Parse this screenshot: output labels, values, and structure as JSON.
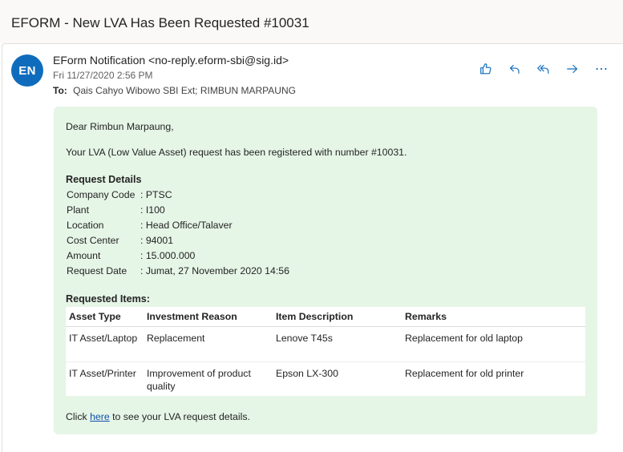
{
  "subject": "EFORM - New LVA Has Been Requested #10031",
  "sender": {
    "initials": "EN",
    "display": "EForm Notification <no-reply.eform-sbi@sig.id>",
    "date": "Fri 11/27/2020 2:56 PM",
    "to_label": "To:",
    "to": "Qais Cahyo Wibowo SBI Ext; RIMBUN MARPAUNG",
    "avatar_color": "#0f6cbd"
  },
  "actions": [
    {
      "name": "like",
      "icon": "thumbs-up-icon"
    },
    {
      "name": "reply",
      "icon": "reply-icon"
    },
    {
      "name": "reply-all",
      "icon": "reply-all-icon"
    },
    {
      "name": "forward",
      "icon": "forward-icon"
    },
    {
      "name": "more",
      "icon": "more-icon"
    }
  ],
  "body": {
    "background": "#e5f5e6",
    "greeting": "Dear Rimbun Marpaung,",
    "intro": "Your LVA (Low Value Asset) request has been registered with number #10031.",
    "details_heading": "Request Details",
    "details": [
      {
        "label": "Company Code",
        "value": ": PTSC"
      },
      {
        "label": "Plant",
        "value": ": I100"
      },
      {
        "label": "Location",
        "value": ": Head Office/Talaver"
      },
      {
        "label": "Cost Center",
        "value": ": 94001"
      },
      {
        "label": "Amount",
        "value": ": 15.000.000"
      },
      {
        "label": "Request Date",
        "value": ": Jumat, 27 November 2020 14:56"
      }
    ],
    "items_heading": "Requested Items:",
    "items_columns": [
      "Asset Type",
      "Investment Reason",
      "Item Description",
      "Remarks"
    ],
    "items": [
      {
        "asset_type": "IT Asset/Laptop",
        "reason": "Replacement",
        "description": "Lenove T45s",
        "remarks": "Replacement for old laptop"
      },
      {
        "asset_type": "IT Asset/Printer",
        "reason": "Improvement of product quality",
        "description": "Epson LX-300",
        "remarks": "Replacement for old printer"
      }
    ],
    "footer_prefix": "Click ",
    "footer_link": "here",
    "footer_suffix": " to see your LVA request details."
  }
}
